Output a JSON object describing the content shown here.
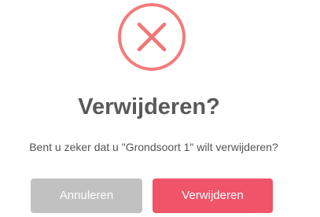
{
  "dialog": {
    "icon": "error-x-icon",
    "icon_color": "#f27474",
    "title": "Verwijderen?",
    "message": "Bent u zeker dat u \"Grondsoort 1\" wilt verwijderen?",
    "cancel_label": "Annuleren",
    "confirm_label": "Verwijderen",
    "cancel_color": "#c1c1c1",
    "confirm_color": "#ef5468"
  }
}
